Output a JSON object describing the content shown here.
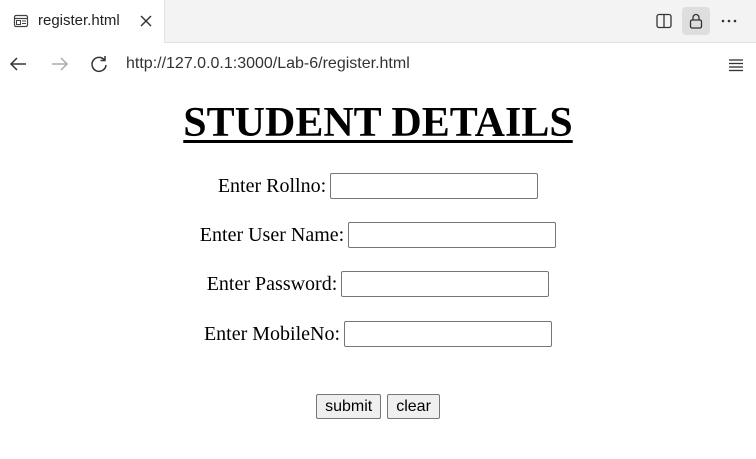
{
  "browser": {
    "tab_title": "register.html",
    "url": "http://127.0.0.1:3000/Lab-6/register.html"
  },
  "page": {
    "heading": "STUDENT DETAILS",
    "fields": [
      {
        "label": "Enter Rollno:",
        "value": ""
      },
      {
        "label": "Enter User Name:",
        "value": ""
      },
      {
        "label": "Enter Password:",
        "value": ""
      },
      {
        "label": "Enter MobileNo:",
        "value": ""
      }
    ],
    "submit_label": "submit",
    "clear_label": "clear"
  }
}
